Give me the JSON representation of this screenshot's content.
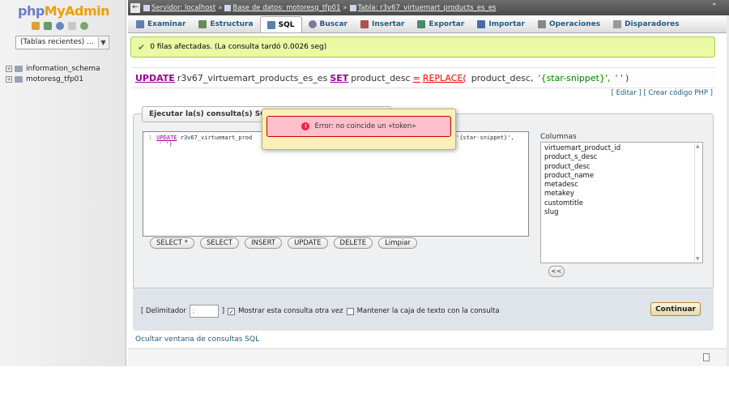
{
  "nav": {
    "logo_part1": "php",
    "logo_part2": "MyAdmin",
    "icons": [
      "home-icon",
      "exit-icon",
      "query-icon",
      "docs-icon",
      "settings-icon"
    ],
    "recent_label": "(Tablas recientes) ...",
    "databases": [
      "information_schema",
      "motoresg_tfp01"
    ]
  },
  "breadcrumb": {
    "server": "Servidor: localhost",
    "database": "Base de datos: motoresg_tfp01",
    "table": "Tabla: r3v67_virtuemart_products_es_es",
    "sep": "»"
  },
  "tabs": [
    {
      "label": "Examinar",
      "icon": "browse-icon",
      "color": "#5f7fb5"
    },
    {
      "label": "Estructura",
      "icon": "structure-icon",
      "color": "#6a8a5a"
    },
    {
      "label": "SQL",
      "icon": "sql-icon",
      "color": "#5b7fae"
    },
    {
      "label": "Buscar",
      "icon": "search-icon",
      "color": "#7a7aa0"
    },
    {
      "label": "Insertar",
      "icon": "insert-icon",
      "color": "#b05050"
    },
    {
      "label": "Exportar",
      "icon": "export-icon",
      "color": "#4a8a6a"
    },
    {
      "label": "Importar",
      "icon": "import-icon",
      "color": "#4a6aaa"
    },
    {
      "label": "Operaciones",
      "icon": "operations-icon",
      "color": "#888888"
    },
    {
      "label": "Disparadores",
      "icon": "triggers-icon",
      "color": "#999999"
    }
  ],
  "active_tab": "SQL",
  "success": {
    "message": "0 filas afectadas. (La consulta tardó 0.0026 seg)"
  },
  "query": {
    "kw_update": "UPDATE",
    "table": "r3v67_virtuemart_products_es_es",
    "kw_set": "SET",
    "column": "product_desc",
    "eq": "=",
    "fn_replace": "REPLACE(",
    "arg1": "product_desc,",
    "arg2": "'{star-snippet}',",
    "arg3": "' '",
    "close": ")"
  },
  "links": {
    "edit": "Editar",
    "php": "Crear código PHP"
  },
  "sql_panel": {
    "legend": "Ejecutar la(s) consulta(s) SQL en l",
    "editor_line_no": "1",
    "editor_kw": "UPDATE",
    "editor_code": " r3v67_virtuemart_prod",
    "editor_tail": "'{star-snippet}',",
    "editor_line2": " ' ')",
    "buttons": [
      "SELECT *",
      "SELECT",
      "INSERT",
      "UPDATE",
      "DELETE",
      "Limpiar"
    ],
    "columns_label": "Columnas",
    "columns": [
      "virtuemart_product_id",
      "product_s_desc",
      "product_desc",
      "product_name",
      "metadesc",
      "metakey",
      "customtitle",
      "slug"
    ],
    "insert_button": "<<"
  },
  "options": {
    "delimiter_label_open": "[ Delimitador",
    "delimiter_value": ";",
    "delimiter_label_close": "]",
    "show_again_label": "Mostrar esta consulta otra vez",
    "show_again_checked": "✓",
    "keep_box_label": "Mantener la caja de texto con la consulta",
    "submit": "Continuar"
  },
  "hide_link": "Ocultar ventana de consultas SQL",
  "modal": {
    "error": "Error: no coincide un «token»",
    "icon": "error-icon"
  }
}
